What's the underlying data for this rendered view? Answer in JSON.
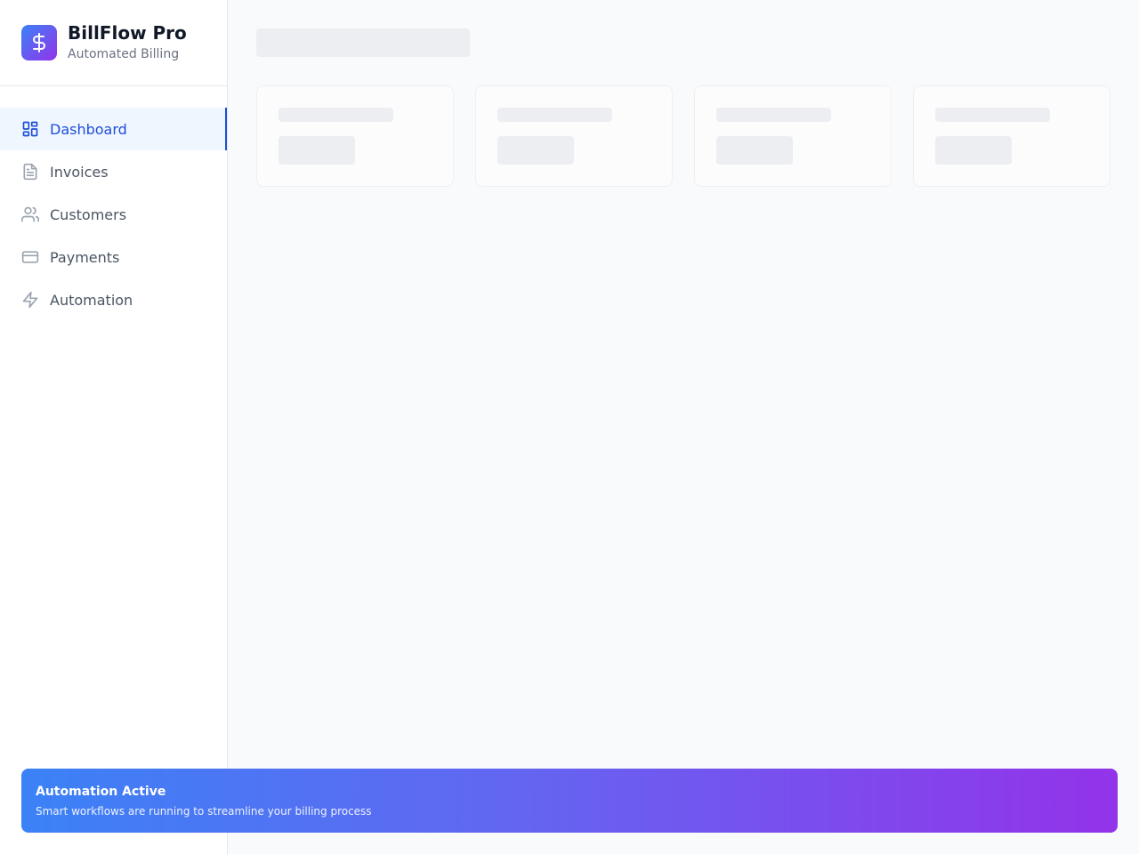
{
  "brand": {
    "title": "BillFlow Pro",
    "subtitle": "Automated Billing",
    "logo_icon": "dollar-icon"
  },
  "sidebar": {
    "items": [
      {
        "label": "Dashboard",
        "icon": "dashboard-icon",
        "active": true
      },
      {
        "label": "Invoices",
        "icon": "document-icon",
        "active": false
      },
      {
        "label": "Customers",
        "icon": "users-icon",
        "active": false
      },
      {
        "label": "Payments",
        "icon": "credit-card-icon",
        "active": false
      },
      {
        "label": "Automation",
        "icon": "lightning-icon",
        "active": false
      }
    ]
  },
  "banner": {
    "title": "Automation Active",
    "text": "Smart workflows are running to streamline your billing process"
  },
  "colors": {
    "accent": "#1d4ed8",
    "gradient_start": "#3b82f6",
    "gradient_end": "#9333ea"
  }
}
